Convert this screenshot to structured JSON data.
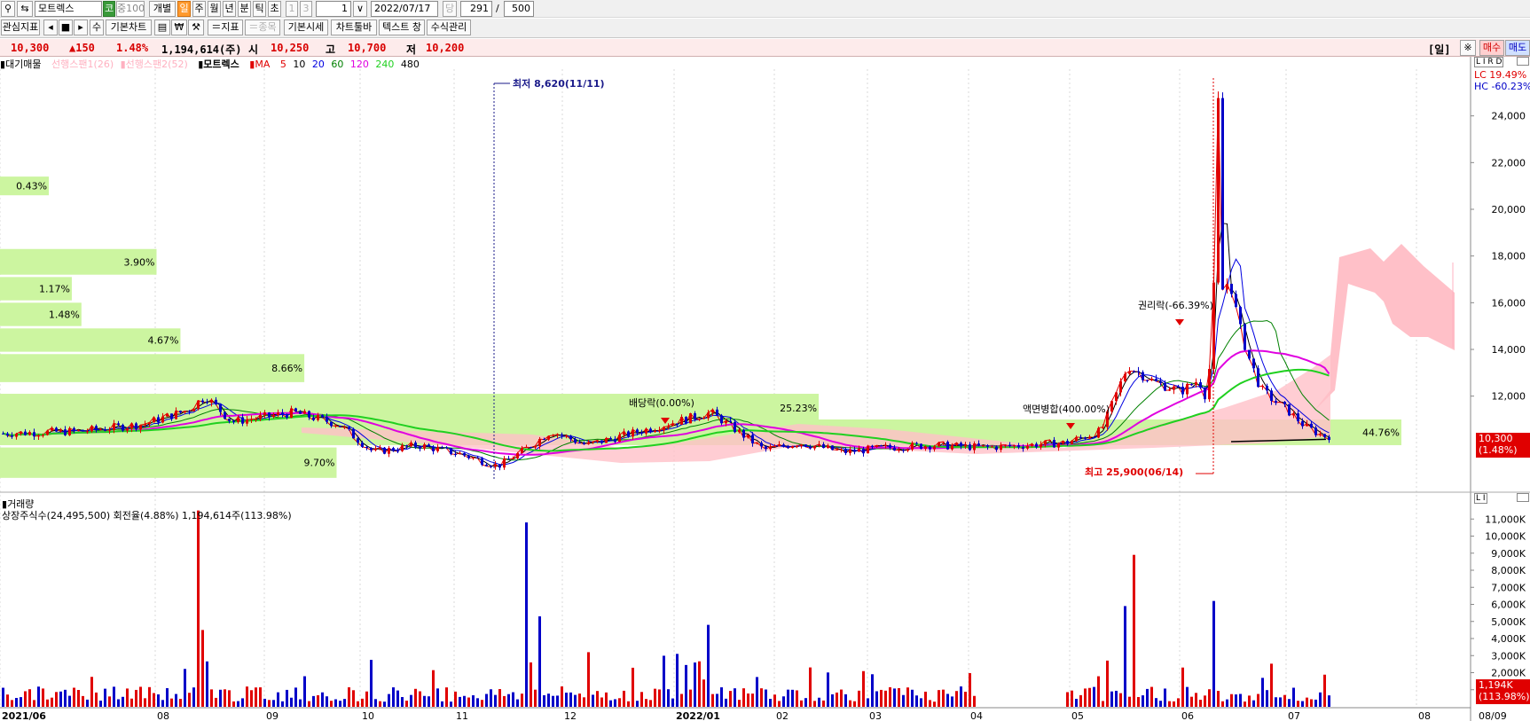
{
  "toolbar1": {
    "stock_name": "모트렉스",
    "market_badge": "코",
    "index_badge": "중100",
    "mode_label": "개별",
    "period_buttons": [
      "일",
      "주",
      "월",
      "년",
      "분",
      "틱",
      "초"
    ],
    "period_selected": "일",
    "disabled_buttons": [
      "1",
      "3"
    ],
    "interval_value": "1",
    "date_value": "2022/07/17",
    "dang_label": "당",
    "count_value": "291",
    "slash": "/",
    "total_value": "500"
  },
  "toolbar2": {
    "watch_label": "관심지표",
    "arrows": [
      "◂",
      "■",
      "▸"
    ],
    "su_label": "수",
    "basic_chart_label": "기본차트",
    "indicator_label": "＝지표",
    "stock_label": "＝종목",
    "quote_label": "기본시세",
    "toolbar_label": "차트툴바",
    "text_window_label": "텍스트 창",
    "formula_label": "수식관리"
  },
  "pricebar": {
    "price": "10,300",
    "change": "▲150",
    "change_pct": "1.48%",
    "volume": "1,194,614(주)",
    "open_label": "시",
    "open": "10,250",
    "high_label": "고",
    "high": "10,700",
    "low_label": "저",
    "low": "10,200",
    "period_tag": "[일]",
    "settings_icon_text": "※",
    "buy_label": "매수",
    "sell_label": "매도"
  },
  "legend": {
    "items": [
      "대기매물",
      "선행스팬1(26)",
      "선행스팬2(52)",
      "모트렉스",
      "MA",
      "5",
      "10",
      "20",
      "60",
      "120",
      "240",
      "480"
    ]
  },
  "price_chart": {
    "ylim": [
      8000,
      26000
    ],
    "y_ticks": [
      "24,000",
      "22,000",
      "20,000",
      "18,000",
      "16,000",
      "14,000",
      "12,000"
    ],
    "lc_label": "LC  19.49%",
    "hc_label": "HC -60.23%",
    "current_price_label": "10,300",
    "current_pct_label": "(1.48%)",
    "annotations": {
      "low_52w": "최저 8,620(11/11)",
      "high_52w": "최고 25,900(06/14)",
      "dividend": "배당락(0.00%)",
      "rights": "권리락(-66.39%)",
      "split": "액면병합(400.00%)"
    },
    "supply_zones": [
      {
        "label": "0.43%",
        "price_low": 20600,
        "price_high": 21400,
        "share": 0.43
      },
      {
        "label": "3.90%",
        "price_low": 17200,
        "price_high": 18300,
        "share": 3.9
      },
      {
        "label": "1.17%",
        "price_low": 16100,
        "price_high": 17100,
        "share": 1.17
      },
      {
        "label": "1.48%",
        "price_low": 15000,
        "price_high": 16000,
        "share": 1.48
      },
      {
        "label": "4.67%",
        "price_low": 13900,
        "price_high": 14900,
        "share": 4.67
      },
      {
        "label": "8.66%",
        "price_low": 12600,
        "price_high": 13800,
        "share": 8.66
      },
      {
        "label": "25.23%",
        "price_low": 10900,
        "price_high": 12100,
        "share": 25.23
      },
      {
        "label": "44.76%",
        "price_low": 9900,
        "price_high": 11000,
        "share": 44.76
      },
      {
        "label": "9.70%",
        "price_low": 8500,
        "price_high": 9800,
        "share": 9.7
      }
    ]
  },
  "volume_chart": {
    "title": "거래량",
    "info": "상장주식수(24,495,500) 회전율(4.88%) 1,194,614주(113.98%)",
    "ylim": [
      0,
      12000
    ],
    "y_ticks": [
      "11,000K",
      "10,000K",
      "9,000K",
      "8,000K",
      "7,000K",
      "6,000K",
      "5,000K",
      "4,000K",
      "3,000K",
      "2,000K",
      "1,000K"
    ],
    "current_label": "1,194K",
    "current_pct_label": "(113.98%)"
  },
  "x_axis": {
    "labels": [
      "2021/06",
      "08",
      "09",
      "10",
      "11",
      "12",
      "2022/01",
      "02",
      "03",
      "04",
      "05",
      "06",
      "07",
      "08",
      "08/09"
    ]
  },
  "colors": {
    "up": "#e00000",
    "down": "#0000c8",
    "zone": "#ccf5a0",
    "cloud": "#ffc0c8",
    "ma5": "#e00000",
    "ma10": "#000000",
    "ma20": "#0000e0",
    "ma60": "#008000",
    "ma120": "#e000e0",
    "ma240": "#20d020"
  },
  "chart_data": [
    {
      "type": "line",
      "title": "모트렉스",
      "x": [
        "2021/06",
        "2021/08",
        "2021/09",
        "2021/10",
        "2021/11",
        "2021/12",
        "2022/01",
        "2022/02",
        "2022/03",
        "2022/04",
        "2022/05",
        "2022/06",
        "2022/07"
      ],
      "series": [
        {
          "name": "모트렉스",
          "values": [
            10400,
            10900,
            10800,
            10300,
            9300,
            10400,
            11300,
            10000,
            9900,
            9900,
            10000,
            17000,
            10300
          ]
        }
      ],
      "ylim": [
        8000,
        26000
      ]
    },
    {
      "type": "bar",
      "title": "거래량",
      "x": [
        "2021/06",
        "2021/08",
        "2021/09",
        "2021/10",
        "2021/11",
        "2021/12",
        "2022/01",
        "2022/02",
        "2022/03",
        "2022/04",
        "2022/05",
        "2022/06",
        "2022/07"
      ],
      "series": [
        {
          "name": "거래량",
          "values": [
            300,
            11500,
            1500,
            400,
            300,
            10800,
            4800,
            500,
            400,
            400,
            8900,
            6200,
            1194
          ]
        }
      ],
      "ylim": [
        0,
        12000
      ]
    }
  ]
}
